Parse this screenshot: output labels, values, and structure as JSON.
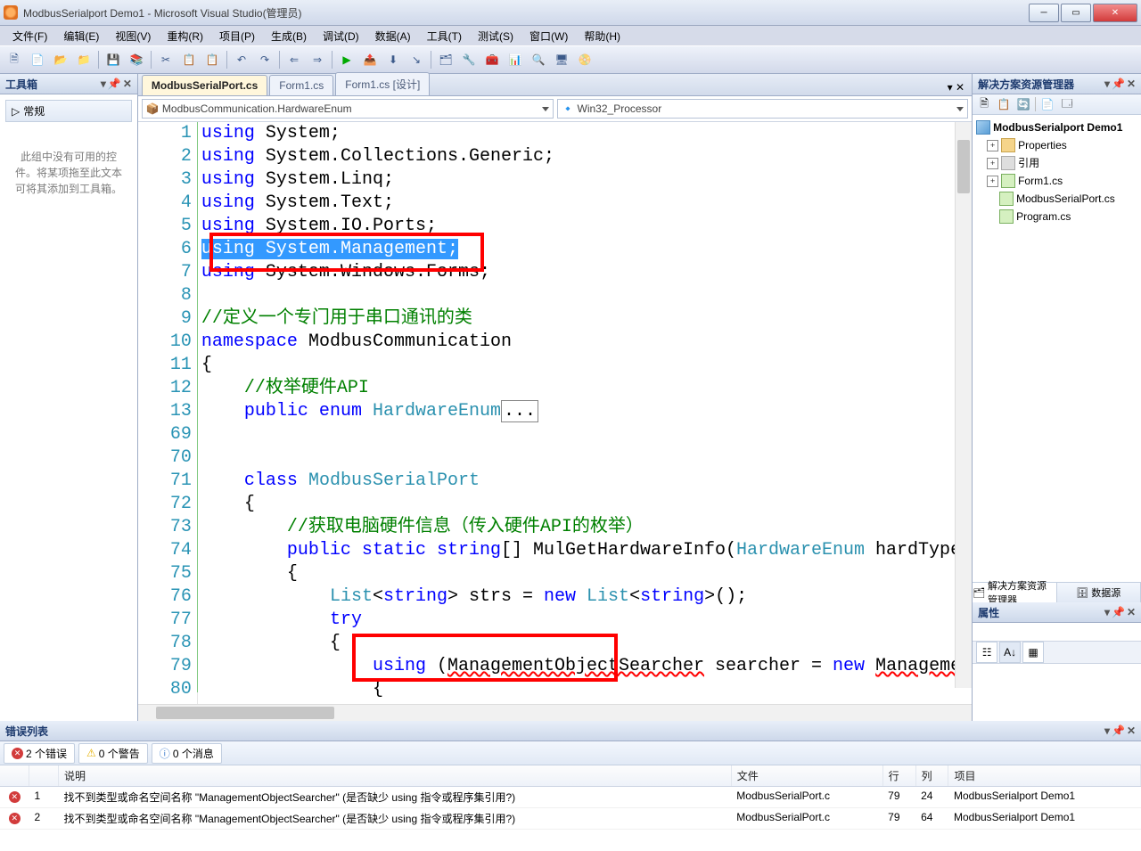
{
  "title": "ModbusSerialport Demo1 - Microsoft Visual Studio(管理员)",
  "menu": [
    "文件(F)",
    "编辑(E)",
    "视图(V)",
    "重构(R)",
    "项目(P)",
    "生成(B)",
    "调试(D)",
    "数据(A)",
    "工具(T)",
    "测试(S)",
    "窗口(W)",
    "帮助(H)"
  ],
  "toolbox": {
    "title": "工具箱",
    "category": "常规",
    "message": "此组中没有可用的控件。将某项拖至此文本可将其添加到工具箱。"
  },
  "tabs": [
    "ModbusSerialPort.cs",
    "Form1.cs",
    "Form1.cs [设计]"
  ],
  "nav": {
    "left": "ModbusCommunication.HardwareEnum",
    "right": "Win32_Processor"
  },
  "code_lines": [
    {
      "n": 1,
      "html": "<span class='kw'>using</span> System;"
    },
    {
      "n": 2,
      "html": "<span class='kw'>using</span> System.Collections.Generic;"
    },
    {
      "n": 3,
      "html": "<span class='kw'>using</span> System.Linq;"
    },
    {
      "n": 4,
      "html": "<span class='kw'>using</span> System.Text;"
    },
    {
      "n": 5,
      "html": "<span class='kw'>using</span> System.IO.Ports;"
    },
    {
      "n": 6,
      "html": "<span class='hl'><span style='color:#fff'>using</span> System.Management;</span>"
    },
    {
      "n": 7,
      "html": "<span class='kw'>using</span> System.Windows.Forms;"
    },
    {
      "n": 8,
      "html": ""
    },
    {
      "n": 9,
      "html": "<span class='cmt'>//定义一个专门用于串口通讯的类</span>"
    },
    {
      "n": 10,
      "html": "<span class='kw'>namespace</span> ModbusCommunication"
    },
    {
      "n": 11,
      "html": "{"
    },
    {
      "n": 12,
      "html": "    <span class='cmt'>//枚举硬件API</span>"
    },
    {
      "n": 13,
      "html": "    <span class='kw'>public enum</span> <span class='type'>HardwareEnum</span><span style='border:1px solid #888;padding:0 2px;'>...</span>"
    },
    {
      "n": 69,
      "html": ""
    },
    {
      "n": 70,
      "html": ""
    },
    {
      "n": 71,
      "html": "    <span class='kw'>class</span> <span class='type'>ModbusSerialPort</span>"
    },
    {
      "n": 72,
      "html": "    {"
    },
    {
      "n": 73,
      "html": "        <span class='cmt'>//获取电脑硬件信息（传入硬件API的枚举）</span>"
    },
    {
      "n": 74,
      "html": "        <span class='kw'>public static string</span>[] MulGetHardwareInfo(<span class='type'>HardwareEnum</span> hardType,"
    },
    {
      "n": 75,
      "html": "        {"
    },
    {
      "n": 76,
      "html": "            <span class='type'>List</span>&lt;<span class='kw'>string</span>&gt; strs = <span class='kw'>new</span> <span class='type'>List</span>&lt;<span class='kw'>string</span>&gt;();"
    },
    {
      "n": 77,
      "html": "            <span class='kw'>try</span>"
    },
    {
      "n": 78,
      "html": "            {"
    },
    {
      "n": 79,
      "html": "                <span class='kw'>using</span> (<span style='text-decoration:underline wavy red;'>ManagementObjectSearcher</span> searcher = <span class='kw'>new</span> <span style='text-decoration:underline wavy red;'>Manageme</span>"
    },
    {
      "n": 80,
      "html": "                {"
    }
  ],
  "solution": {
    "title": "解决方案资源管理器",
    "root": "ModbusSerialport Demo1",
    "items": [
      "Properties",
      "引用",
      "Form1.cs",
      "ModbusSerialPort.cs",
      "Program.cs"
    ]
  },
  "panel_tabs": {
    "sol": "解决方案资源管理器",
    "data": "数据源"
  },
  "props": {
    "title": "属性"
  },
  "errlist": {
    "title": "错误列表",
    "filters": {
      "err": "2 个错误",
      "warn": "0 个警告",
      "info": "0 个消息"
    },
    "cols": [
      "",
      "",
      "说明",
      "文件",
      "行",
      "列",
      "项目"
    ],
    "rows": [
      {
        "n": "1",
        "desc": "找不到类型或命名空间名称 \"ManagementObjectSearcher\" (是否缺少 using 指令或程序集引用?)",
        "file": "ModbusSerialPort.c",
        "line": "79",
        "col": "24",
        "proj": "ModbusSerialport Demo1"
      },
      {
        "n": "2",
        "desc": "找不到类型或命名空间名称 \"ManagementObjectSearcher\" (是否缺少 using 指令或程序集引用?)",
        "file": "ModbusSerialPort.c",
        "line": "79",
        "col": "64",
        "proj": "ModbusSerialport Demo1"
      }
    ]
  }
}
